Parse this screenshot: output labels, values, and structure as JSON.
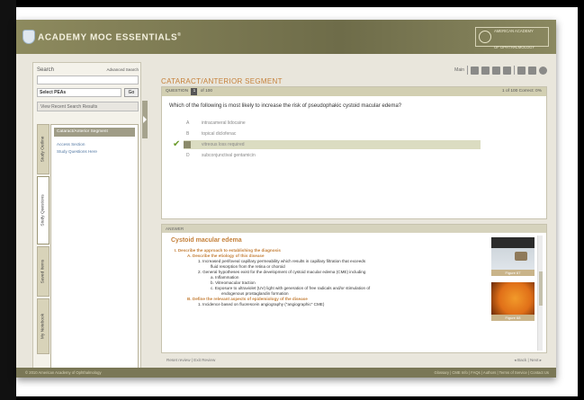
{
  "app": {
    "title": "ACADEMY MOC ESSENTIALS",
    "trademark": "®",
    "aao_lines": [
      "American Academy",
      "of Ophthalmology"
    ]
  },
  "left": {
    "search_label": "Search",
    "advanced_label": "Advanced Search",
    "select_value": "Select PEAs",
    "go_label": "Go",
    "recent_label": "View Recent Search Results",
    "tabs": [
      "Study Outline",
      "Study Questions",
      "Saved Items",
      "My Notebook"
    ],
    "segment_header": "Cataract/Anterior Segment",
    "sub_links": [
      "Access Section",
      "Study Questions Here"
    ]
  },
  "toolbar": {
    "main_label": "Main"
  },
  "segment_title": "CATARACT/ANTERIOR SEGMENT",
  "question": {
    "header_label": "QUESTION",
    "number": "1",
    "of_label": "of 100",
    "status": "1 of 100 Correct: 0%",
    "text": "Which of the following is most likely to increase the risk of pseudophakic cystoid macular edema?",
    "answers": [
      {
        "letter": "A",
        "text": "intracameral lidocaine"
      },
      {
        "letter": "B",
        "text": "topical diclofenac"
      },
      {
        "letter": "C",
        "text": "vitreous loss required"
      },
      {
        "letter": "D",
        "text": "subconjunctival gentamicin"
      }
    ]
  },
  "answer": {
    "header_label": "ANSWER",
    "title": "Cystoid macular edema",
    "outline": [
      "I.   Describe the approach to establishing the diagnosis",
      "A.   Describe the etiology of this disease",
      "1.   Increased perifoveal capillary permeability which results in capillary filtration that exceeds",
      "fluid resorption from the retina or choroid",
      "2.   General hypotheses exist for the development of cystoid macular edema (CME) including",
      "a.   Inflammation",
      "b.   Vitreomacular traction",
      "c.   Exposure to ultraviolet (UV) light with generation of free radicals and/or stimulation of",
      "endogenous prostaglandin formation",
      "B.   Define the relevant aspects of epidemiology of the disease",
      "1.   Incidence based on fluorescein angiography (\"angiographic\" CME)"
    ],
    "figures": [
      "Figure 67",
      "Figure 68"
    ]
  },
  "nav": {
    "left_links": "Reset review  |  Exit Review",
    "right_links": "◂ Back  |  Next ▸"
  },
  "footer": {
    "copyright": "© 2010 American Academy of Ophthalmology",
    "links": "Glossary  |  CME Info  |  FAQs  |  Authors  |  Terms of Service  |  Contact Us"
  },
  "colors": {
    "accent": "#c5813b",
    "title_bar": "#7a7756",
    "link": "#5278a3"
  }
}
